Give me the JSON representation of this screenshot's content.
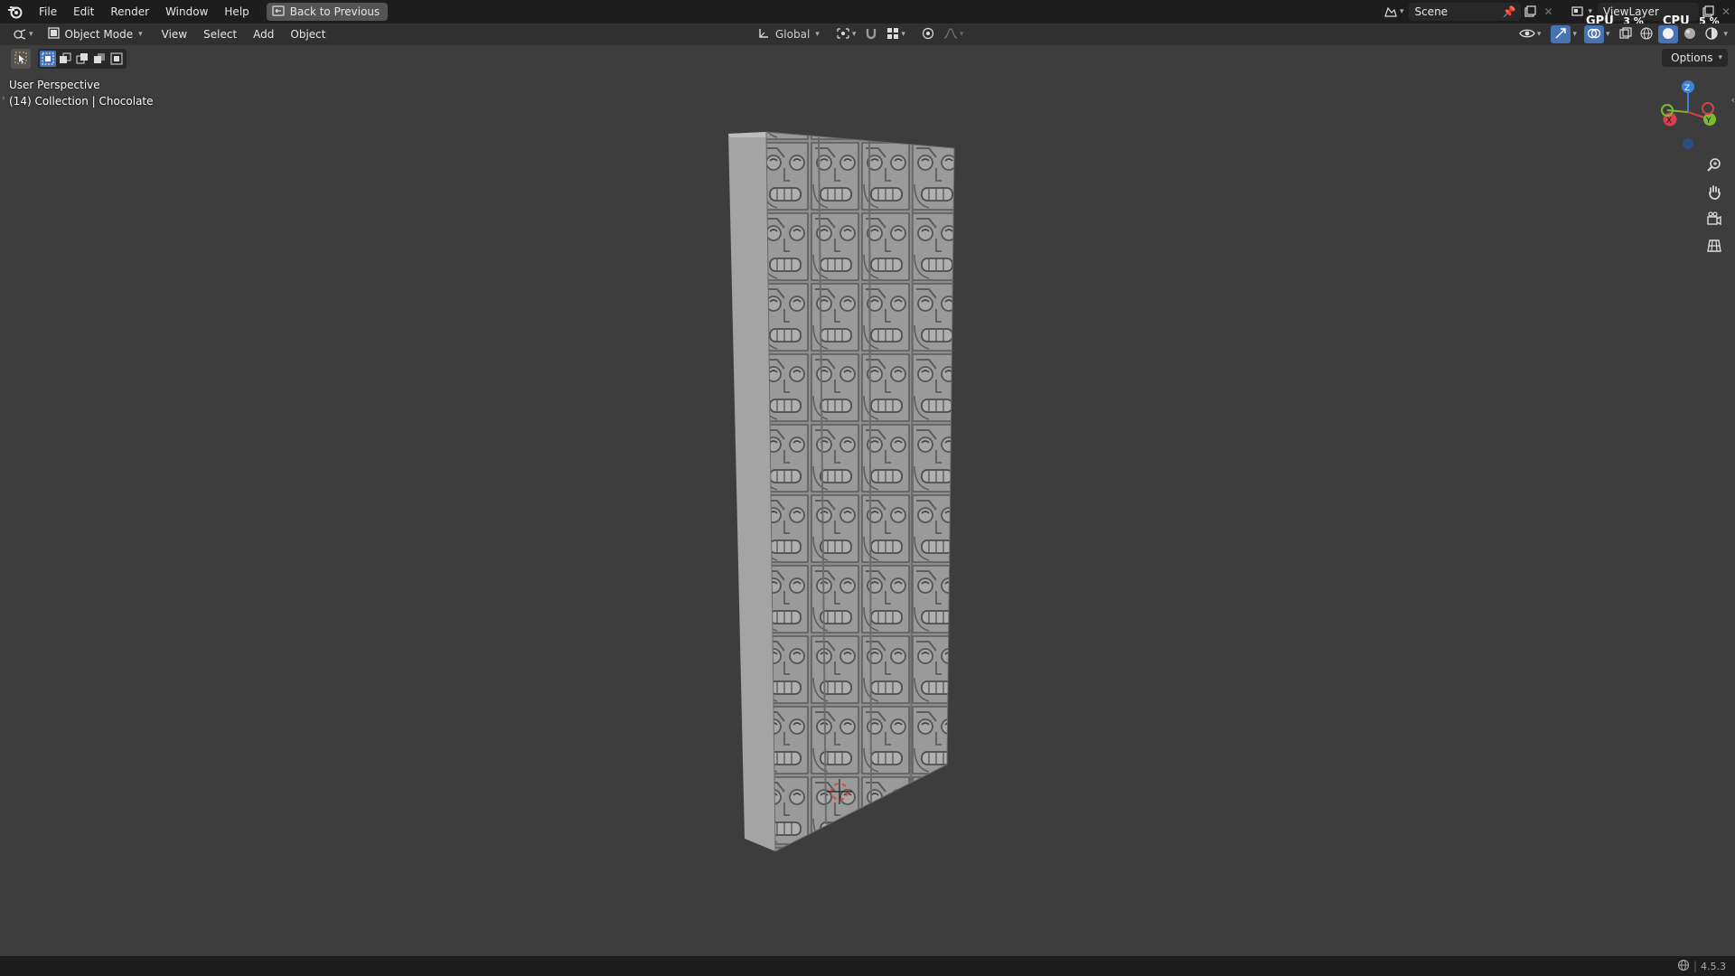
{
  "topbar": {
    "menu": [
      "File",
      "Edit",
      "Render",
      "Window",
      "Help"
    ],
    "back_button": "Back to Previous",
    "scene_name": "Scene",
    "view_layer": "ViewLayer",
    "gpu_label": "GPU",
    "gpu_value": "3 %",
    "cpu_label": "CPU",
    "cpu_value": "5 %"
  },
  "header": {
    "mode": "Object Mode",
    "menu": [
      "View",
      "Select",
      "Add",
      "Object"
    ],
    "transform_orientation": "Global",
    "options_label": "Options"
  },
  "viewport": {
    "perspective_label": "User Perspective",
    "collection_label": "(14) Collection | Chocolate",
    "gizmo_axes": [
      "Z",
      "Y",
      "X"
    ],
    "colors": {
      "background": "#3d3d3d",
      "object_face": "#8f8f8f",
      "object_side": "#a6a6a6",
      "x_axis": "#d4404f",
      "y_axis": "#7cb82f",
      "z_axis": "#3b82d9"
    }
  },
  "status": {
    "version": "4.5.3"
  }
}
